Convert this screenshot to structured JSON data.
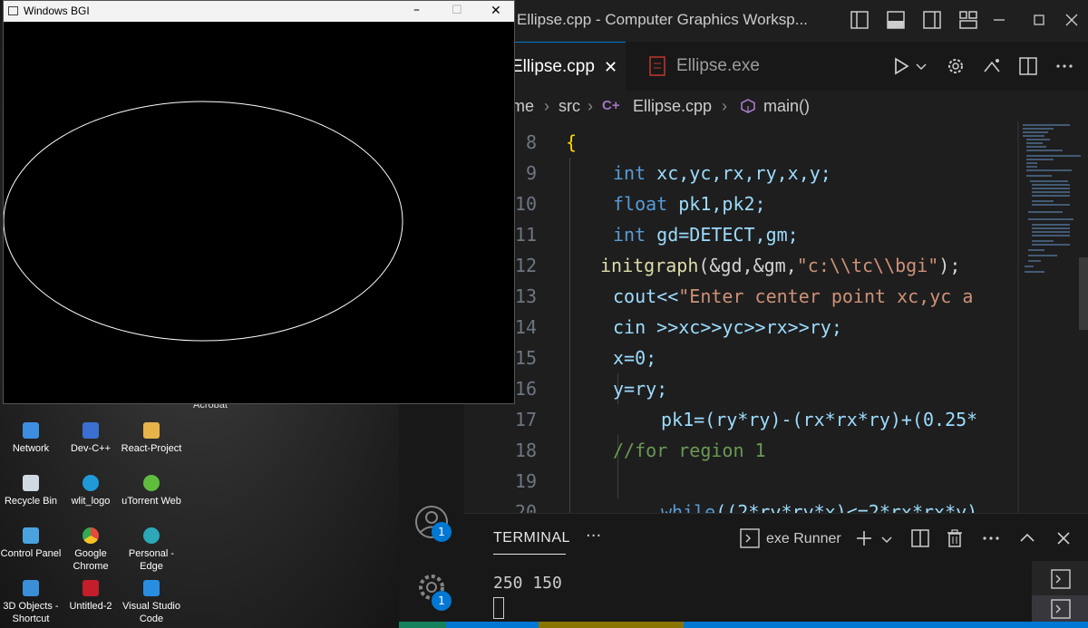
{
  "desktop": {
    "acrobat_label": "Acrobat",
    "icons": [
      {
        "label": "Network",
        "color": "#3d8ee0"
      },
      {
        "label": "Dev-C++",
        "color": "#3b6fd1"
      },
      {
        "label": "React-Project",
        "color": "#e8b44a"
      },
      {
        "label": "Recycle Bin",
        "color": "#cfd8e3"
      },
      {
        "label": "wlit_logo",
        "color": "#1f9ad6"
      },
      {
        "label": "uTorrent Web",
        "color": "#5fbd3e"
      },
      {
        "label": "Control Panel",
        "color": "#4aa3df"
      },
      {
        "label": "Google Chrome",
        "color": "#e64a3b"
      },
      {
        "label": "Personal - Edge",
        "color": "#2ca8b8"
      },
      {
        "label": "3D Objects - Shortcut",
        "color": "#3b8ed8"
      },
      {
        "label": "Untitled-2",
        "color": "#c41e2a"
      },
      {
        "label": "Visual Studio Code",
        "color": "#2a8ee0"
      }
    ]
  },
  "bgi": {
    "title": "Windows BGI",
    "minimize": "–",
    "maximize": "☐",
    "close": "✕"
  },
  "vscode": {
    "title": "Ellipse.cpp - Computer Graphics Worksp...",
    "tabs": [
      {
        "label": "Ellipse.cpp",
        "close": "✕"
      },
      {
        "label": "Ellipse.exe"
      }
    ],
    "breadcrumb": {
      "part1": "me",
      "part2": "src",
      "file": "Ellipse.cpp",
      "symbol": "main()"
    },
    "line_numbers": [
      "8",
      "9",
      "10",
      "11",
      "12",
      "13",
      "14",
      "15",
      "16",
      "17",
      "18",
      "19",
      "20"
    ],
    "code": {
      "l8": "{",
      "l9a": "int",
      "l9b": " xc,yc,rx,ry,x,y;",
      "l10a": "float",
      "l10b": " pk1,pk2;",
      "l11a": "int",
      "l11b": " gd=DETECT,gm;",
      "l12a": "initgraph",
      "l12b": "(&gd,&gm,",
      "l12c": "\"c:\\\\tc\\\\bgi\"",
      "l12d": ");",
      "l13a": "cout<<",
      "l13b": "\"Enter center point xc,yc a",
      "l14": "cin >>xc>>yc>>rx>>ry;",
      "l15": "x=0;",
      "l16": "y=ry;",
      "l17": "pk1=(ry*ry)-(rx*rx*ry)+(0.25*",
      "l18": "//for region 1",
      "l19": "",
      "l20a": "while",
      "l20b": "((2*ry*ry*x)<=2*rx*rx*y)"
    },
    "terminal": {
      "tab": "TERMINAL",
      "more": "···",
      "runner": "exe Runner",
      "output": "250 150"
    },
    "badges": {
      "accounts": "1",
      "manage": "1"
    }
  }
}
